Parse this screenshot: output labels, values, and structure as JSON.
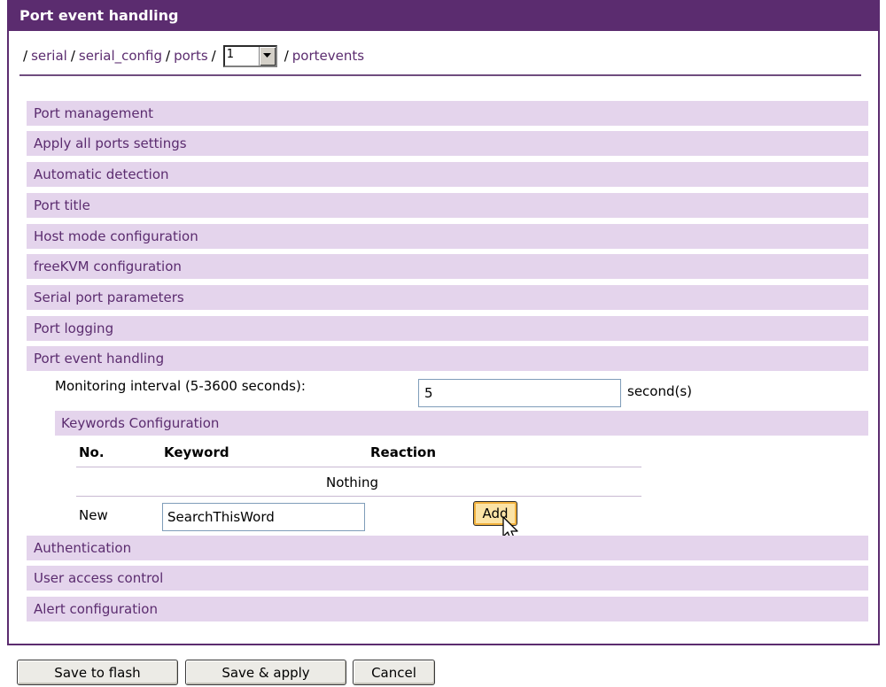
{
  "panel": {
    "title": "Port event handling"
  },
  "breadcrumb": {
    "items": [
      "serial",
      "serial_config",
      "ports"
    ],
    "port_value": "1",
    "last": "portevents"
  },
  "sections": [
    "Port management",
    "Apply all ports settings",
    "Automatic detection",
    "Port title",
    "Host mode configuration",
    "freeKVM configuration",
    "Serial port parameters",
    "Port logging",
    "Port event handling",
    "Authentication",
    "User access control",
    "Alert configuration"
  ],
  "monitoring": {
    "label": "Monitoring interval (5-3600 seconds):",
    "value": "5",
    "unit": "second(s)"
  },
  "keywords": {
    "title": "Keywords Configuration",
    "columns": [
      "No.",
      "Keyword",
      "Reaction"
    ],
    "empty_text": "Nothing",
    "new_label": "New",
    "new_value": "SearchThisWord",
    "add_label": "Add"
  },
  "footer": {
    "save_flash": "Save to flash",
    "save_apply": "Save & apply",
    "cancel": "Cancel"
  },
  "colors": {
    "header_bg": "#5b2c6f",
    "section_bg": "#e4d4ec",
    "section_text": "#5b2c6f"
  }
}
